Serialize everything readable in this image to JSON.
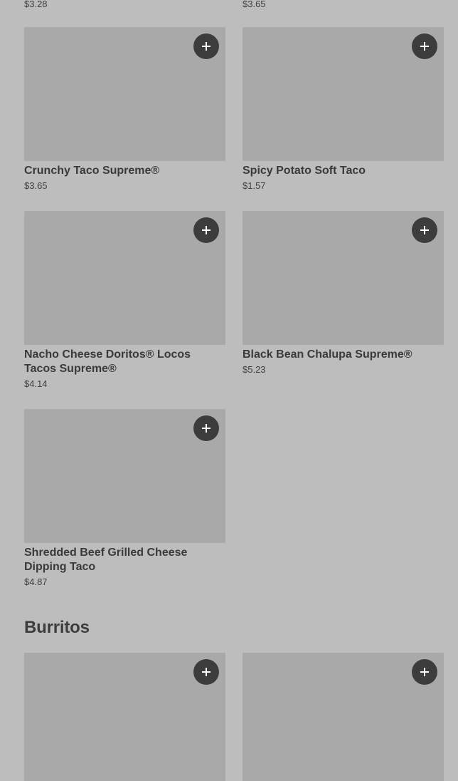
{
  "colors": {
    "background": "#bdbdbd",
    "image_placeholder": "#a9a9a9",
    "add_button": "#3c3c3c",
    "text": "#3a3a3a"
  },
  "top_row": {
    "left_price": "$3.28",
    "right_price": "$3.65"
  },
  "tacos": [
    {
      "name": "Crunchy Taco Supreme®",
      "price": "$3.65",
      "icon": "plus-icon"
    },
    {
      "name": "Spicy Potato Soft Taco",
      "price": "$1.57",
      "icon": "plus-icon"
    },
    {
      "name": "Nacho Cheese Doritos® Locos Tacos Supreme®",
      "price": "$4.14",
      "icon": "plus-icon"
    },
    {
      "name": "Black Bean Chalupa Supreme®",
      "price": "$5.23",
      "icon": "plus-icon"
    },
    {
      "name": "Shredded Beef Grilled Cheese Dipping Taco",
      "price": "$4.87",
      "icon": "plus-icon"
    }
  ],
  "burritos_section": {
    "title": "Burritos"
  }
}
